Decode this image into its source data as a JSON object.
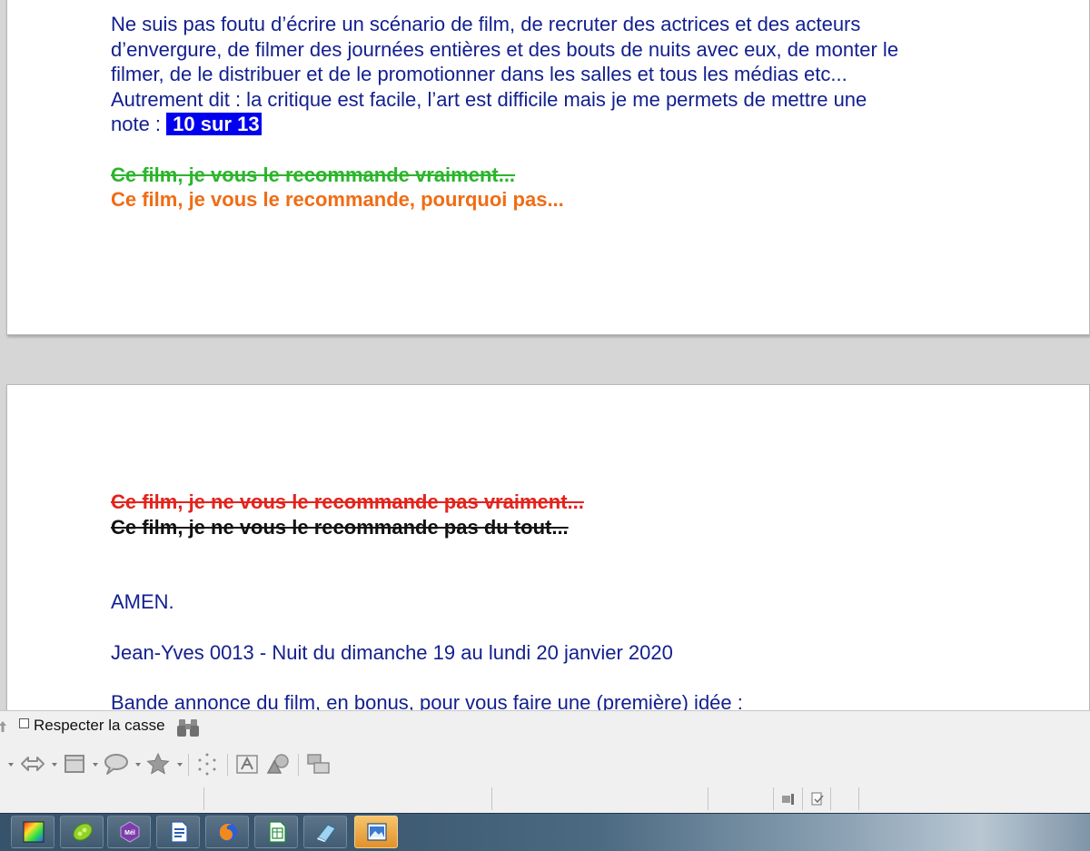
{
  "document": {
    "page1": {
      "line1": "Ne suis pas foutu d’écrire un scénario de film, de recruter des actrices et des acteurs",
      "line2": "d’envergure, de filmer des journées entières et des bouts de nuits avec eux, de monter le",
      "line3": "filmer, de le distribuer et de le promotionner dans les salles et tous les médias etc...",
      "line4": "Autrement dit : la critique est facile, l’art est difficile mais je me permets de mettre une",
      "note_prefix": "note :  ",
      "note_value": "10 sur 13",
      "rec_green": "Ce film, je vous le recommande vraiment...",
      "rec_orange": "Ce film, je vous le recommande, pourquoi  pas..."
    },
    "page2": {
      "rec_red": "Ce film, je ne vous le recommande pas vraiment...",
      "rec_black": "Ce film, je ne vous le recommande pas du tout...",
      "amen": "AMEN.",
      "signature": "Jean-Yves 0013  -  Nuit du dimanche 19 au lundi 20 janvier 2020",
      "trailer": "Bande annonce du film, en bonus, pour vous faire une (première) idée  :"
    }
  },
  "find_toolbar": {
    "match_case_label": "Respecter la casse",
    "match_case_checked": false
  },
  "colors": {
    "body_text": "#13208f",
    "highlight_bg": "#0000ee",
    "green": "#2bb52b",
    "orange": "#f06c14",
    "red": "#e3231c"
  },
  "icons": {
    "find_toolbar": [
      "find-previous-icon",
      "binoculars-icon"
    ],
    "drawing_toolbar": [
      "arrows-icon",
      "rectangle-shape-icon",
      "callout-icon",
      "star-icon",
      "points-icon",
      "fontwork-icon",
      "shapes-icon",
      "align-objects-icon"
    ],
    "status_bar": [
      "view-layout-icon",
      "document-modified-icon"
    ],
    "taskbar": [
      "color-picker-app-icon",
      "pea-app-icon",
      "mail-app-icon",
      "writer-app-icon",
      "firefox-app-icon",
      "calc-app-icon",
      "eraser-app-icon",
      "image-viewer-app-icon"
    ]
  }
}
